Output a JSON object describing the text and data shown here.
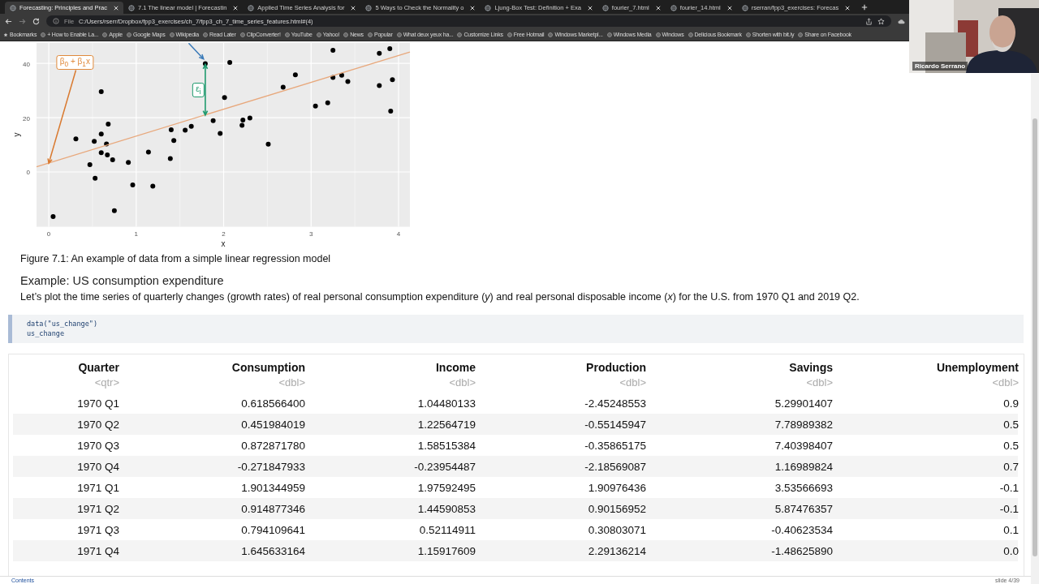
{
  "browser": {
    "tabs": [
      {
        "title": "Forecasting: Principles and Prac",
        "selected": true
      },
      {
        "title": "7.1 The linear model | Forecastin",
        "selected": false
      },
      {
        "title": "Applied Time Series Analysis for",
        "selected": false
      },
      {
        "title": "5 Ways to Check the Normality o",
        "selected": false
      },
      {
        "title": "Ljung-Box Test: Definition + Exa",
        "selected": false
      },
      {
        "title": "fourier_7.html",
        "selected": false
      },
      {
        "title": "fourier_14.html",
        "selected": false
      },
      {
        "title": "rserran/fpp3_exercises: Forecas",
        "selected": false
      }
    ],
    "address": {
      "scheme": "File",
      "url": "C:/Users/rserr/Dropbox/fpp3_exercises/ch_7/fpp3_ch_7_time_series_features.html#(4)"
    },
    "bookmarks": [
      "Bookmarks",
      "+ How to Enable La...",
      "Apple",
      "Google Maps",
      "Wikipedia",
      "Read Later",
      "ClipConverter!",
      "YouTube",
      "Yahoo!",
      "News",
      "Popular",
      "What deux yeux ha...",
      "Customize Links",
      "Free Hotmail",
      "Windows Marketpl...",
      "Windows Media",
      "Windows",
      "Delicious Bookmark",
      "Shorten with bit.ly",
      "Share on Facebook"
    ]
  },
  "webcam": {
    "name": "Ricardo Serrano"
  },
  "figure": {
    "chart_data": {
      "type": "scatter",
      "xlabel": "x",
      "ylabel": "y",
      "xlim": [
        -0.14,
        4.13
      ],
      "ylim": [
        -20.2,
        47.5
      ],
      "xticks": [
        0,
        1,
        2,
        3,
        4
      ],
      "yticks": [
        0,
        20,
        40
      ],
      "grid": true,
      "series": [
        {
          "color": "#000000",
          "x": [
            0.05,
            0.31,
            0.47,
            0.52,
            0.53,
            0.6,
            0.6,
            0.6,
            0.66,
            0.67,
            0.68,
            0.73,
            0.75,
            0.91,
            0.96,
            1.14,
            1.19,
            1.39,
            1.4,
            1.43,
            1.56,
            1.63,
            1.79,
            1.88,
            1.96,
            2.01,
            2.07,
            2.21,
            2.22,
            2.3,
            2.51,
            2.68,
            2.82,
            3.05,
            3.19,
            3.25,
            3.25,
            3.35,
            3.42,
            3.78,
            3.78,
            3.9,
            3.91,
            3.93
          ],
          "values": [
            -16.4,
            12.2,
            2.7,
            11.3,
            -2.3,
            29.6,
            14.0,
            7.1,
            10.3,
            6.3,
            17.6,
            4.5,
            -14.3,
            3.5,
            -4.8,
            7.3,
            -5.2,
            4.9,
            15.5,
            11.6,
            15.4,
            16.8,
            39.9,
            18.9,
            14.2,
            27.4,
            40.3,
            17.2,
            19.1,
            19.9,
            10.2,
            31.2,
            35.8,
            24.3,
            25.5,
            44.8,
            34.8,
            35.6,
            33.3,
            43.7,
            31.8,
            45.4,
            22.4,
            34.0
          ]
        },
        {
          "type": "line",
          "color": "#e8a87c",
          "x": [
            -0.14,
            4.13
          ],
          "values": [
            1.9,
            44.2
          ]
        }
      ],
      "annotations": [
        "β$_{0}$ + β$_{1}$x",
        "ε$_{i}$"
      ]
    },
    "caption": "Figure 7.1: An example of data from a simple linear regression model"
  },
  "section": {
    "heading": "Example: US consumption expenditure",
    "text": "Let’s plot the time series of quarterly changes (growth rates) of real personal consumption expenditure (*y*) and real personal disposable income (*x*) for the U.S. from 1970 Q1 and 2019 Q2."
  },
  "code": [
    "data(\"us_change\")",
    "us_change"
  ],
  "table": {
    "columns": [
      {
        "name": "Quarter",
        "type": "<qtr>"
      },
      {
        "name": "Consumption",
        "type": "<dbl>"
      },
      {
        "name": "Income",
        "type": "<dbl>"
      },
      {
        "name": "Production",
        "type": "<dbl>"
      },
      {
        "name": "Savings",
        "type": "<dbl>"
      },
      {
        "name": "Unemployment",
        "type": "<dbl>"
      }
    ],
    "rows": [
      [
        "1970 Q1",
        "0.618566400",
        "1.04480133",
        "-2.45248553",
        "5.29901407",
        "0.9"
      ],
      [
        "1970 Q2",
        "0.451984019",
        "1.22564719",
        "-0.55145947",
        "7.78989382",
        "0.5"
      ],
      [
        "1970 Q3",
        "0.872871780",
        "1.58515384",
        "-0.35865175",
        "7.40398407",
        "0.5"
      ],
      [
        "1970 Q4",
        "-0.271847933",
        "-0.23954487",
        "-2.18569087",
        "1.16989824",
        "0.7"
      ],
      [
        "1971 Q1",
        "1.901344959",
        "1.97592495",
        "1.90976436",
        "3.53566693",
        "-0.1"
      ],
      [
        "1971 Q2",
        "0.914877346",
        "1.44590853",
        "0.90156952",
        "5.87476357",
        "-0.1"
      ],
      [
        "1971 Q3",
        "0.794109641",
        "0.52114911",
        "0.30803071",
        "-0.40623534",
        "0.1"
      ],
      [
        "1971 Q4",
        "1.645633164",
        "1.15917609",
        "2.29136214",
        "-1.48625890",
        "0.0"
      ]
    ]
  },
  "footer": {
    "link": "Contents",
    "slide": "slide 4/39"
  }
}
